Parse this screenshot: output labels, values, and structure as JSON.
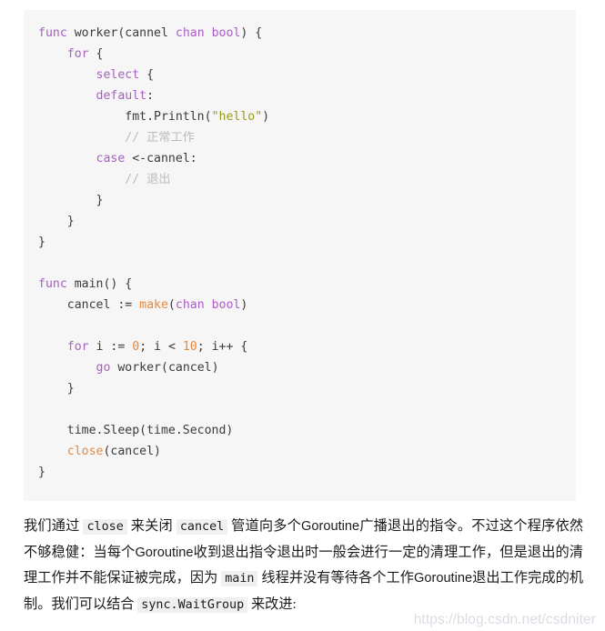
{
  "code_block": {
    "language": "go",
    "background_color": "#f6f6f6",
    "colors": {
      "keyword": "#a85fc0",
      "builtin_function": "#e8883a",
      "string": "#9a9a1a",
      "number": "#e8883a",
      "comment": "#bcbcbc",
      "plain": "#3b3b3b"
    },
    "lines": [
      [
        {
          "t": "kw",
          "s": "func"
        },
        {
          "t": "pl",
          "s": " worker("
        },
        {
          "t": "pl",
          "s": "cannel "
        },
        {
          "t": "kw",
          "s": "chan bool"
        },
        {
          "t": "pl",
          "s": ") {"
        }
      ],
      [
        {
          "t": "pl",
          "s": "    "
        },
        {
          "t": "kw",
          "s": "for"
        },
        {
          "t": "pl",
          "s": " {"
        }
      ],
      [
        {
          "t": "pl",
          "s": "        "
        },
        {
          "t": "kw",
          "s": "select"
        },
        {
          "t": "pl",
          "s": " {"
        }
      ],
      [
        {
          "t": "pl",
          "s": "        "
        },
        {
          "t": "kw",
          "s": "default"
        },
        {
          "t": "pl",
          "s": ":"
        }
      ],
      [
        {
          "t": "pl",
          "s": "            fmt.Println("
        },
        {
          "t": "str",
          "s": "\"hello\""
        },
        {
          "t": "pl",
          "s": ")"
        }
      ],
      [
        {
          "t": "pl",
          "s": "            "
        },
        {
          "t": "com",
          "s": "// 正常工作"
        }
      ],
      [
        {
          "t": "pl",
          "s": "        "
        },
        {
          "t": "kw",
          "s": "case"
        },
        {
          "t": "pl",
          "s": " <-cannel:"
        }
      ],
      [
        {
          "t": "pl",
          "s": "            "
        },
        {
          "t": "com",
          "s": "// 退出"
        }
      ],
      [
        {
          "t": "pl",
          "s": "        }"
        }
      ],
      [
        {
          "t": "pl",
          "s": "    }"
        }
      ],
      [
        {
          "t": "pl",
          "s": "}"
        }
      ],
      [
        {
          "t": "pl",
          "s": ""
        }
      ],
      [
        {
          "t": "kw",
          "s": "func"
        },
        {
          "t": "pl",
          "s": " main() {"
        }
      ],
      [
        {
          "t": "pl",
          "s": "    cancel := "
        },
        {
          "t": "fn",
          "s": "make"
        },
        {
          "t": "pl",
          "s": "("
        },
        {
          "t": "kw",
          "s": "chan bool"
        },
        {
          "t": "pl",
          "s": ")"
        }
      ],
      [
        {
          "t": "pl",
          "s": ""
        }
      ],
      [
        {
          "t": "pl",
          "s": "    "
        },
        {
          "t": "kw",
          "s": "for"
        },
        {
          "t": "pl",
          "s": " i := "
        },
        {
          "t": "num",
          "s": "0"
        },
        {
          "t": "pl",
          "s": "; i < "
        },
        {
          "t": "num",
          "s": "10"
        },
        {
          "t": "pl",
          "s": "; i++ {"
        }
      ],
      [
        {
          "t": "pl",
          "s": "        "
        },
        {
          "t": "kw",
          "s": "go"
        },
        {
          "t": "pl",
          "s": " worker(cancel)"
        }
      ],
      [
        {
          "t": "pl",
          "s": "    }"
        }
      ],
      [
        {
          "t": "pl",
          "s": ""
        }
      ],
      [
        {
          "t": "pl",
          "s": "    time.Sleep(time.Second)"
        }
      ],
      [
        {
          "t": "pl",
          "s": "    "
        },
        {
          "t": "fn",
          "s": "close"
        },
        {
          "t": "pl",
          "s": "(cancel)"
        }
      ],
      [
        {
          "t": "pl",
          "s": "}"
        }
      ]
    ]
  },
  "prose": {
    "segments": [
      {
        "type": "text",
        "s": "我们通过 "
      },
      {
        "type": "code",
        "s": "close"
      },
      {
        "type": "text",
        "s": " 来关闭 "
      },
      {
        "type": "code",
        "s": "cancel"
      },
      {
        "type": "text",
        "s": " 管道向多个"
      },
      {
        "type": "latin",
        "s": "Goroutine"
      },
      {
        "type": "text",
        "s": "广播退出的指令。不过这个程序依然不够稳健：当每个"
      },
      {
        "type": "latin",
        "s": "Goroutine"
      },
      {
        "type": "text",
        "s": "收到退出指令退出时一般会进行一定的清理工作，但是退出的清理工作并不能保证被完成，因为 "
      },
      {
        "type": "code",
        "s": "main"
      },
      {
        "type": "text",
        "s": " 线程并没有等待各个工作"
      },
      {
        "type": "latin",
        "s": "Goroutine"
      },
      {
        "type": "text",
        "s": "退出工作完成的机制。我们可以结合 "
      },
      {
        "type": "code",
        "s": "sync.WaitGroup"
      },
      {
        "type": "text",
        "s": " 来改进:"
      }
    ]
  },
  "watermark": {
    "text": "https://blog.csdn.net/csdniter",
    "color": "#d9dde3"
  }
}
